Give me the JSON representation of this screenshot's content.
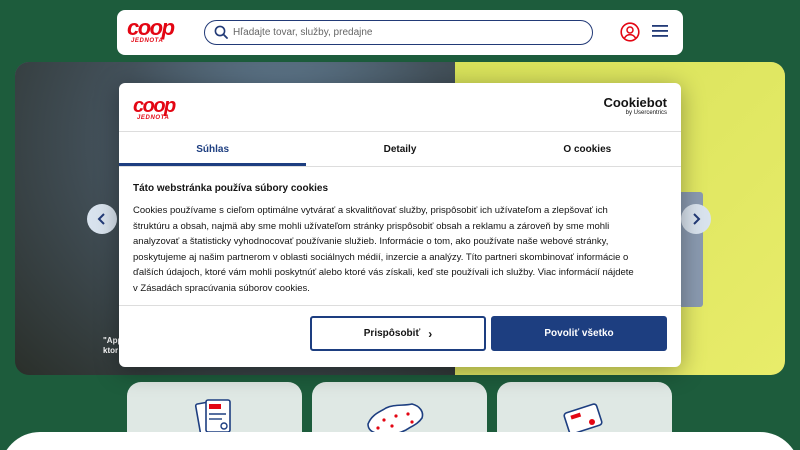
{
  "header": {
    "logo_text": "coop",
    "logo_sub": "JEDNOTA",
    "search_placeholder": "Hľadajte tovar, služby, predajne"
  },
  "banner": {
    "note": "\"Appl",
    "note2": "ktor"
  },
  "cookie_dialog": {
    "logo_text": "coop",
    "logo_sub": "JEDNOTA",
    "brand": "Cookiebot",
    "brand_sub": "by Usercentrics",
    "tabs": [
      {
        "label": "Súhlas",
        "active": true
      },
      {
        "label": "Detaily",
        "active": false
      },
      {
        "label": "O cookies",
        "active": false
      }
    ],
    "title": "Táto webstránka používa súbory cookies",
    "lines": [
      "Cookies používame s cieľom optimálne vytvárať a skvalitňovať služby, prispôsobiť ich užívateľom a zlepšovať ich",
      "štruktúru a obsah, najmä aby sme mohli užívateľom stránky prispôsobiť obsah a reklamu a zároveň by sme mohli",
      "analyzovať a štatisticky vyhodnocovať používanie služieb. Informácie o tom, ako používate naše webové stránky,",
      "poskytujeme aj našim partnerom v oblasti sociálnych médií, inzercie a analýzy. Títo partneri skombinovať informácie o",
      "ďalších údajoch, ktoré vám mohli poskytnúť alebo ktoré vás získali, keď ste používali ich služby. Viac informácií nájdete",
      "v Zásadách spracúvania súborov cookies."
    ],
    "btn_customize": "Prispôsobiť",
    "btn_allow": "Povoliť všetko"
  },
  "colors": {
    "background": "#1d5c3c",
    "brand_red": "#e30613",
    "primary": "#1d3e80"
  },
  "icons": [
    "search-icon",
    "account-icon",
    "menu-icon",
    "chevron-left-icon",
    "chevron-right-icon",
    "leaflet-icon",
    "map-icon",
    "loyalty-card-icon"
  ]
}
